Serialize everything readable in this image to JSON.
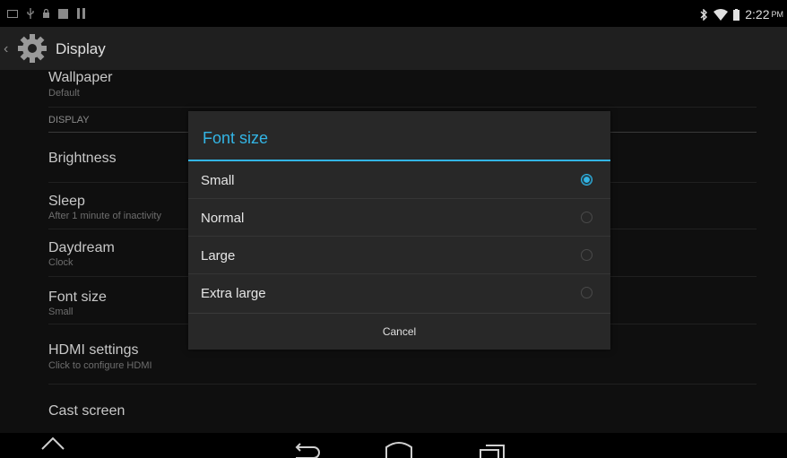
{
  "status_bar": {
    "time": "2:22",
    "ampm": "PM",
    "icons_left": [
      "mail-icon",
      "usb-icon",
      "lock-icon",
      "image-icon",
      "storage-icon"
    ],
    "icons_right": [
      "bluetooth-icon",
      "wifi-icon",
      "battery-icon"
    ]
  },
  "action_bar": {
    "title": "Display",
    "icon": "gear-icon"
  },
  "list": {
    "wallpaper": {
      "title": "Wallpaper",
      "summary": "Default"
    },
    "section_header": "DISPLAY",
    "brightness": {
      "title": "Brightness"
    },
    "sleep": {
      "title": "Sleep",
      "summary": "After 1 minute of inactivity"
    },
    "daydream": {
      "title": "Daydream",
      "summary": "Clock"
    },
    "font_size": {
      "title": "Font size",
      "summary": "Small"
    },
    "hdmi": {
      "title": "HDMI settings",
      "summary": "Click to configure HDMI"
    },
    "cast": {
      "title": "Cast screen"
    }
  },
  "dialog": {
    "title": "Font size",
    "options": [
      {
        "label": "Small",
        "selected": true
      },
      {
        "label": "Normal",
        "selected": false
      },
      {
        "label": "Large",
        "selected": false
      },
      {
        "label": "Extra large",
        "selected": false
      }
    ],
    "cancel_label": "Cancel"
  },
  "colors": {
    "accent": "#33b5e5",
    "dialog_bg": "#282828",
    "background": "#0f0f0f"
  },
  "nav_bar": {
    "buttons": [
      "keyboard-hide-icon",
      "back-icon",
      "home-icon",
      "recents-icon"
    ]
  }
}
